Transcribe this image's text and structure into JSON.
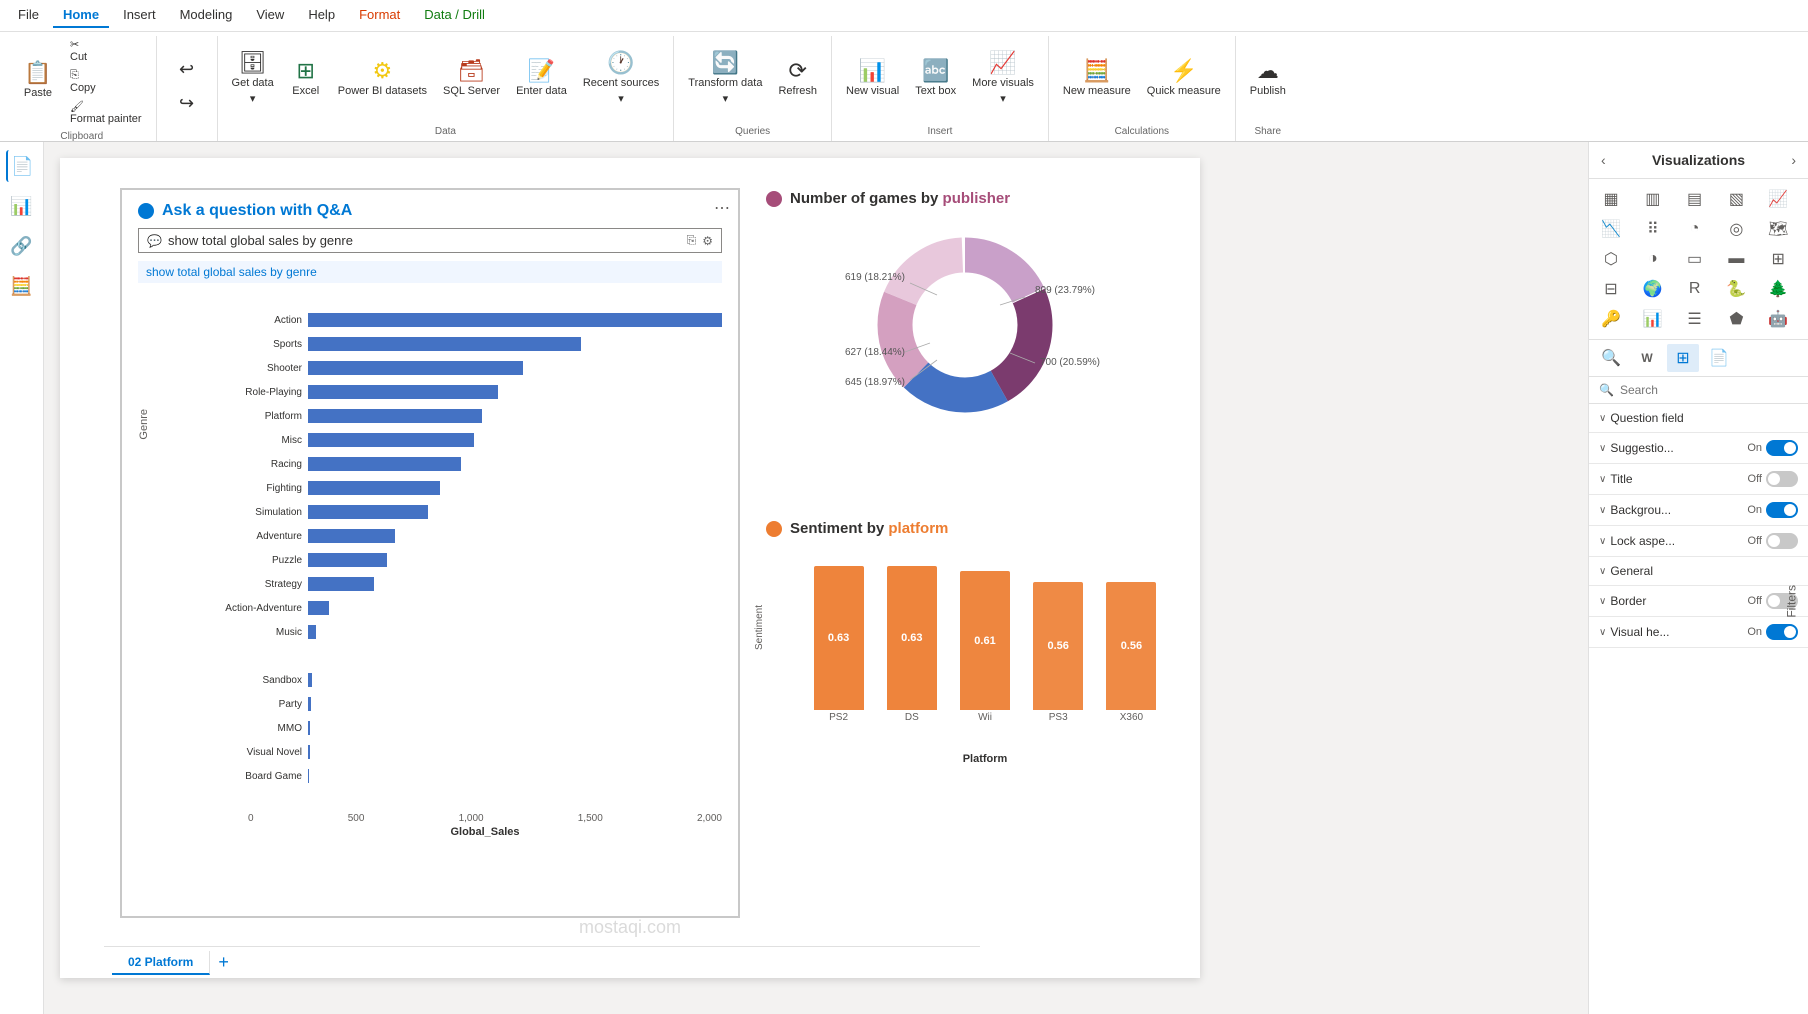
{
  "menu": {
    "items": [
      "File",
      "Home",
      "Insert",
      "Modeling",
      "View",
      "Help",
      "Format",
      "Data / Drill"
    ],
    "active": "Home",
    "highlight": "Format",
    "highlight2": "Data / Drill"
  },
  "ribbon": {
    "clipboard": {
      "label": "Clipboard",
      "paste": "Paste",
      "cut": "Cut",
      "copy": "Copy",
      "format_painter": "Format painter"
    },
    "undo": {
      "undo": "Undo",
      "redo": "Redo"
    },
    "data": {
      "label": "Data",
      "get_data": "Get data",
      "excel": "Excel",
      "power_bi": "Power BI datasets",
      "sql": "SQL Server",
      "enter": "Enter data",
      "recent": "Recent sources"
    },
    "queries": {
      "label": "Queries",
      "transform": "Transform data",
      "refresh": "Refresh"
    },
    "insert": {
      "label": "Insert",
      "new_visual": "New visual",
      "text_box": "Text box",
      "more_visuals": "More visuals"
    },
    "calculations": {
      "label": "Calculations",
      "new_measure": "New measure",
      "quick_measure": "Quick measure"
    },
    "share": {
      "label": "Share",
      "publish": "Publish"
    }
  },
  "qa_visual": {
    "title_before": "Ask a question ",
    "title_highlight": "with Q&A",
    "search_text": "show total global sales by genre",
    "suggestion": "show total global sales by genre",
    "genres": [
      {
        "name": "Action",
        "value": 2000,
        "pct": 100
      },
      {
        "name": "Sports",
        "value": 1330,
        "pct": 66
      },
      {
        "name": "Shooter",
        "value": 1050,
        "pct": 52
      },
      {
        "name": "Role-Playing",
        "value": 930,
        "pct": 46
      },
      {
        "name": "Platform",
        "value": 850,
        "pct": 42
      },
      {
        "name": "Misc",
        "value": 810,
        "pct": 40
      },
      {
        "name": "Racing",
        "value": 740,
        "pct": 37
      },
      {
        "name": "Fighting",
        "value": 640,
        "pct": 32
      },
      {
        "name": "Simulation",
        "value": 590,
        "pct": 29
      },
      {
        "name": "Adventure",
        "value": 420,
        "pct": 21
      },
      {
        "name": "Puzzle",
        "value": 380,
        "pct": 19
      },
      {
        "name": "Strategy",
        "value": 330,
        "pct": 16
      },
      {
        "name": "Action-Adventure",
        "value": 110,
        "pct": 5
      },
      {
        "name": "Music",
        "value": 50,
        "pct": 2
      },
      {
        "name": "",
        "value": 0,
        "pct": 0
      },
      {
        "name": "Sandbox",
        "value": 20,
        "pct": 1
      },
      {
        "name": "Party",
        "value": 15,
        "pct": 0.7
      },
      {
        "name": "MMO",
        "value": 12,
        "pct": 0.6
      },
      {
        "name": "Visual Novel",
        "value": 8,
        "pct": 0.4
      },
      {
        "name": "Board Game",
        "value": 5,
        "pct": 0.25
      }
    ],
    "x_ticks": [
      "0",
      "500",
      "1,000",
      "1,500",
      "2,000"
    ],
    "x_axis_label": "Global_Sales",
    "y_axis_label": "Genre"
  },
  "donut_visual": {
    "title": "Number of games by publisher",
    "segments": [
      {
        "label": "619 (18.21%)",
        "color": "#c9a0c9",
        "pct": 18.21
      },
      {
        "label": "809 (23.79%)",
        "color": "#7b3b6e",
        "pct": 23.79
      },
      {
        "label": "700 (20.59%)",
        "color": "#4472c4",
        "pct": 20.59
      },
      {
        "label": "645 (18.97%)",
        "color": "#d9a0c0",
        "pct": 18.97
      },
      {
        "label": "627 (18.44%)",
        "color": "#e8c0d8",
        "pct": 18.44
      }
    ]
  },
  "sentiment_visual": {
    "title_before": "Sentiment ",
    "title_by": "by ",
    "title_highlight": "platform",
    "bars": [
      {
        "platform": "PS2",
        "value": 0.63,
        "height_pct": 90
      },
      {
        "platform": "DS",
        "value": 0.63,
        "height_pct": 90
      },
      {
        "platform": "Wii",
        "value": 0.61,
        "height_pct": 87
      },
      {
        "platform": "PS3",
        "value": 0.56,
        "height_pct": 80
      },
      {
        "platform": "X360",
        "value": 0.56,
        "height_pct": 80
      }
    ],
    "y_label": "Sentiment",
    "x_label": "Platform"
  },
  "visualizations": {
    "title": "Visualizations",
    "icons": [
      {
        "name": "bar-chart-icon",
        "symbol": "▦"
      },
      {
        "name": "stacked-bar-icon",
        "symbol": "▥"
      },
      {
        "name": "clustered-bar-icon",
        "symbol": "▤"
      },
      {
        "name": "100pct-bar-icon",
        "symbol": "▧"
      },
      {
        "name": "line-chart-icon",
        "symbol": "📈"
      },
      {
        "name": "area-chart-icon",
        "symbol": "📉"
      },
      {
        "name": "scatter-icon",
        "symbol": "⠿"
      },
      {
        "name": "pie-icon",
        "symbol": "◔"
      },
      {
        "name": "donut-icon",
        "symbol": "◎"
      },
      {
        "name": "treemap-icon",
        "symbol": "▦"
      },
      {
        "name": "funnel-icon",
        "symbol": "⬡"
      },
      {
        "name": "gauge-icon",
        "symbol": "◑"
      },
      {
        "name": "card-icon",
        "symbol": "▭"
      },
      {
        "name": "multi-row-card-icon",
        "symbol": "▬"
      },
      {
        "name": "table-icon",
        "symbol": "⊞"
      },
      {
        "name": "matrix-icon",
        "symbol": "⊟"
      },
      {
        "name": "map-icon",
        "symbol": "🗺"
      },
      {
        "name": "filled-map-icon",
        "symbol": "🌍"
      },
      {
        "name": "shape-map-icon",
        "symbol": "⬟"
      },
      {
        "name": "kpi-icon",
        "symbol": "📊"
      },
      {
        "name": "slicer-icon",
        "symbol": "☰"
      },
      {
        "name": "r-visual-icon",
        "symbol": "R"
      },
      {
        "name": "python-icon",
        "symbol": "🐍"
      },
      {
        "name": "ai-visual-icon",
        "symbol": "🤖"
      },
      {
        "name": "decomp-tree-icon",
        "symbol": "🌲"
      },
      {
        "name": "key-influencers-icon",
        "symbol": "🔑"
      },
      {
        "name": "qa-icon",
        "symbol": "❓"
      },
      {
        "name": "smart-narrative-icon",
        "symbol": "📝"
      },
      {
        "name": "more-visuals-icon",
        "symbol": "⋯"
      }
    ],
    "search_placeholder": "Search"
  },
  "properties": {
    "question_field": {
      "label": "Question field"
    },
    "suggestions": {
      "label": "Suggestio...",
      "value": "On",
      "on": true
    },
    "title": {
      "label": "Title",
      "value": "Off",
      "on": false
    },
    "background": {
      "label": "Backgrou...",
      "value": "On",
      "on": true
    },
    "lock_aspect": {
      "label": "Lock aspe...",
      "value": "Off",
      "on": false
    },
    "general": {
      "label": "General"
    },
    "border": {
      "label": "Border",
      "value": "Off",
      "on": false
    },
    "visual_header": {
      "label": "Visual he...",
      "value": "On",
      "on": true
    }
  },
  "filters_label": "Filters",
  "page_tabs": [
    {
      "label": "02 Platform",
      "active": false
    }
  ],
  "watermark": "mostaqi.com"
}
